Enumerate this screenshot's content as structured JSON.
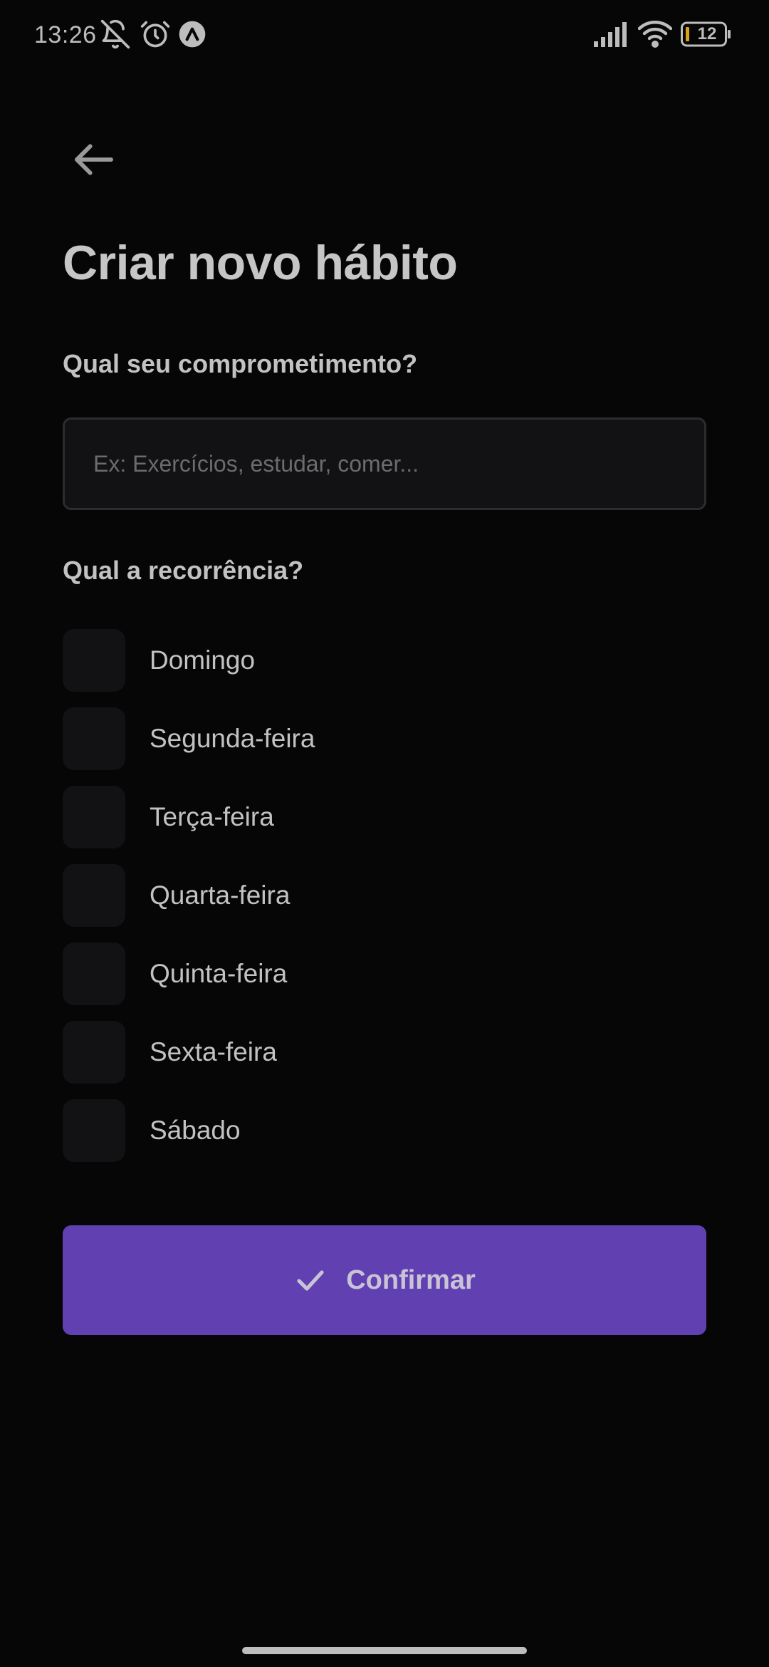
{
  "status_bar": {
    "time": "13:26",
    "battery_level": "12",
    "icons": [
      "bell-muted-icon",
      "alarm-icon",
      "app-notification-icon",
      "signal-icon",
      "wifi-icon",
      "battery-icon"
    ]
  },
  "header": {
    "back_icon": "arrow-left-icon",
    "title": "Criar novo hábito"
  },
  "form": {
    "commitment_label": "Qual seu comprometimento?",
    "commitment_input": {
      "value": "",
      "placeholder": "Ex: Exercícios, estudar, comer..."
    },
    "recurrence_label": "Qual a recorrência?",
    "days": [
      {
        "label": "Domingo",
        "checked": false
      },
      {
        "label": "Segunda-feira",
        "checked": false
      },
      {
        "label": "Terça-feira",
        "checked": false
      },
      {
        "label": "Quarta-feira",
        "checked": false
      },
      {
        "label": "Quinta-feira",
        "checked": false
      },
      {
        "label": "Sexta-feira",
        "checked": false
      },
      {
        "label": "Sábado",
        "checked": false
      }
    ],
    "confirm_label": "Confirmar",
    "confirm_icon": "check-icon"
  },
  "colors": {
    "background": "#060606",
    "accent": "#6140b1",
    "field_bg": "#121214",
    "field_border": "#2c2c30",
    "text": "#c4c4c4",
    "placeholder": "#6b6b70",
    "battery_accent": "#d9a21b"
  }
}
